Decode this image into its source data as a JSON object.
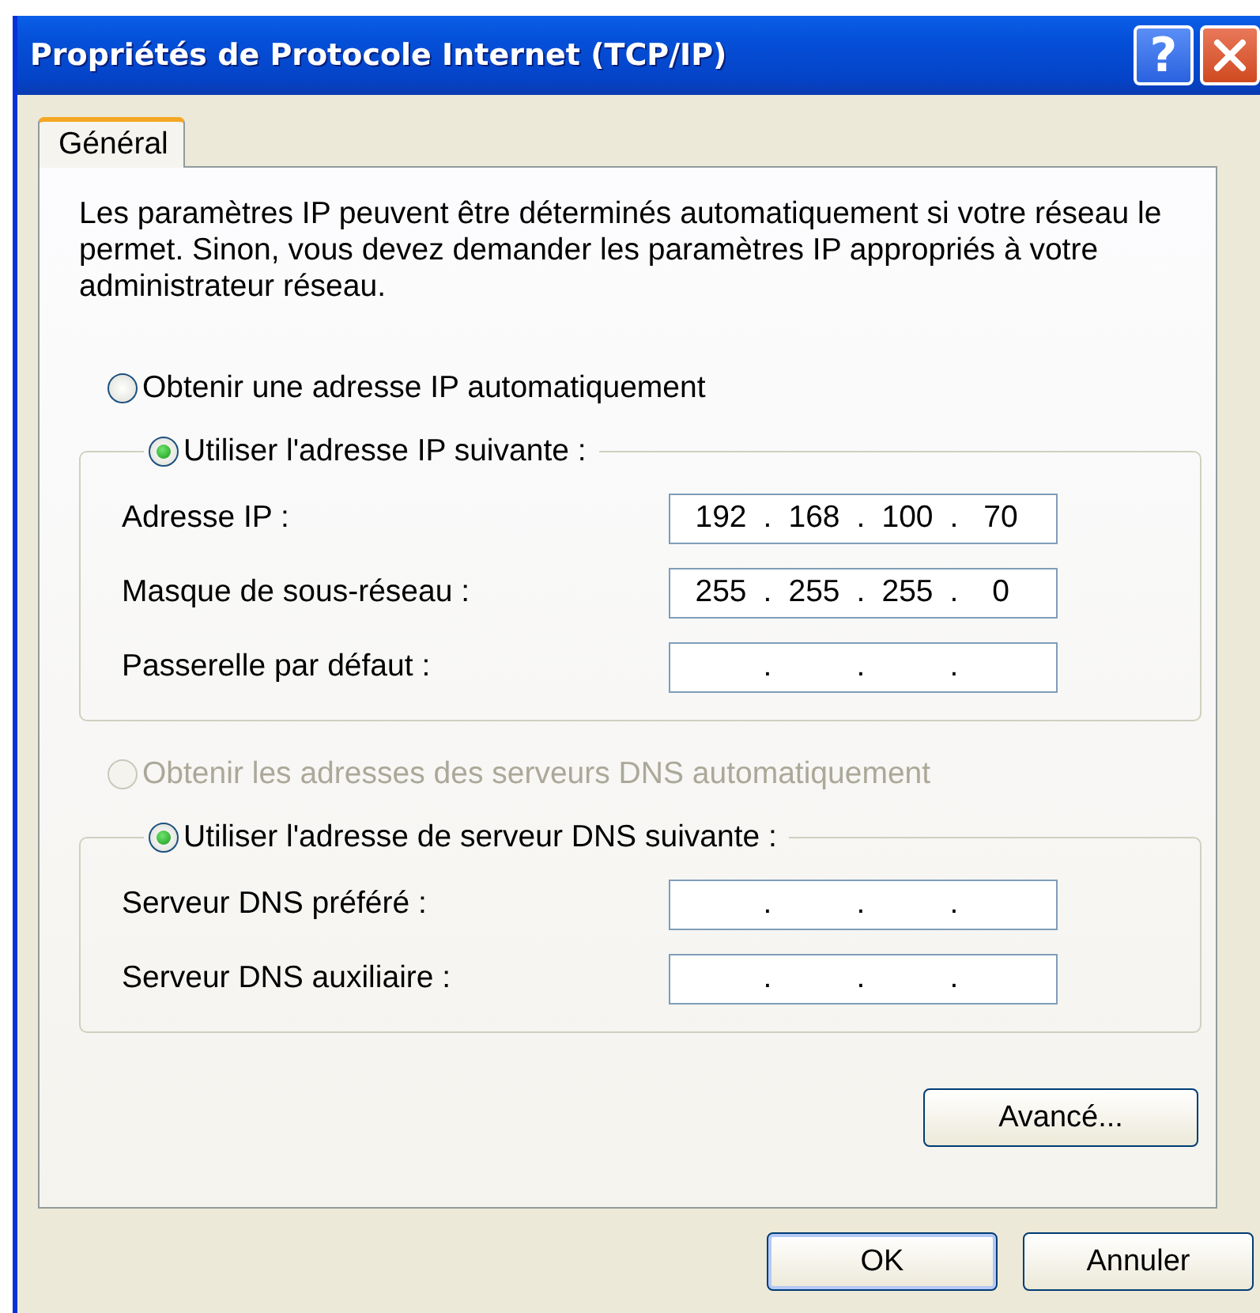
{
  "window": {
    "title": "Propriétés de Protocole Internet (TCP/IP)",
    "help_glyph": "?"
  },
  "tabs": [
    {
      "label": "Général",
      "selected": true
    }
  ],
  "description": "Les paramètres IP peuvent être déterminés automatiquement si votre réseau le permet. Sinon, vous devez demander les paramètres IP appropriés à votre administrateur réseau.",
  "ip_separator": ".",
  "sections": [
    {
      "auto_option": {
        "label": "Obtenir une adresse IP automatiquement",
        "selected": false,
        "disabled": false
      },
      "manual_option": {
        "label": "Utiliser l'adresse IP suivante :",
        "selected": true,
        "disabled": false
      },
      "fields": [
        {
          "label": "Adresse IP :",
          "octets": [
            "192",
            "168",
            "100",
            "70"
          ]
        },
        {
          "label": "Masque de sous-réseau :",
          "octets": [
            "255",
            "255",
            "255",
            "0"
          ]
        },
        {
          "label": "Passerelle par défaut :"
        }
      ]
    },
    {
      "auto_option": {
        "label": "Obtenir les adresses des serveurs DNS automatiquement",
        "selected": false,
        "disabled": true
      },
      "manual_option": {
        "label": "Utiliser l'adresse de serveur DNS suivante :",
        "selected": true,
        "disabled": false
      },
      "fields": [
        {
          "label": "Serveur DNS préféré :"
        },
        {
          "label": "Serveur DNS auxiliaire :"
        }
      ]
    }
  ],
  "advanced_button": "Avancé...",
  "buttons": [
    {
      "label": "OK",
      "kind": "default"
    },
    {
      "label": "Annuler",
      "kind": "normal"
    }
  ]
}
